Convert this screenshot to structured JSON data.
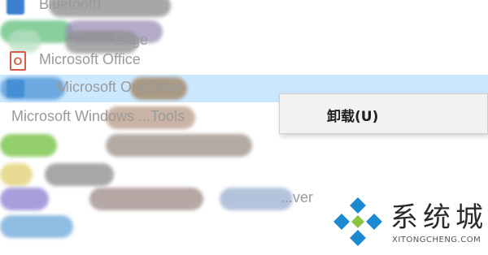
{
  "app_list": {
    "items": [
      {
        "label": "Bluetooth"
      },
      {
        "label": ""
      },
      {
        "label": "Edge"
      },
      {
        "label": "Microsoft Office"
      },
      {
        "label": "Microsoft OneDrive"
      },
      {
        "label": "Microsoft Windows ...Tools"
      },
      {
        "label": ""
      },
      {
        "label": ""
      },
      {
        "label": ""
      },
      {
        "label": "...ver"
      }
    ],
    "selected_index": 4
  },
  "context_menu": {
    "items": [
      {
        "label": "卸载(U)"
      }
    ]
  },
  "watermark": {
    "title": "系统城",
    "subtitle": "XITONGCHENG.COM"
  },
  "colors": {
    "selection": "#cce8ff",
    "logo_blue": "#1b8ad3",
    "logo_green": "#8cc63f"
  }
}
